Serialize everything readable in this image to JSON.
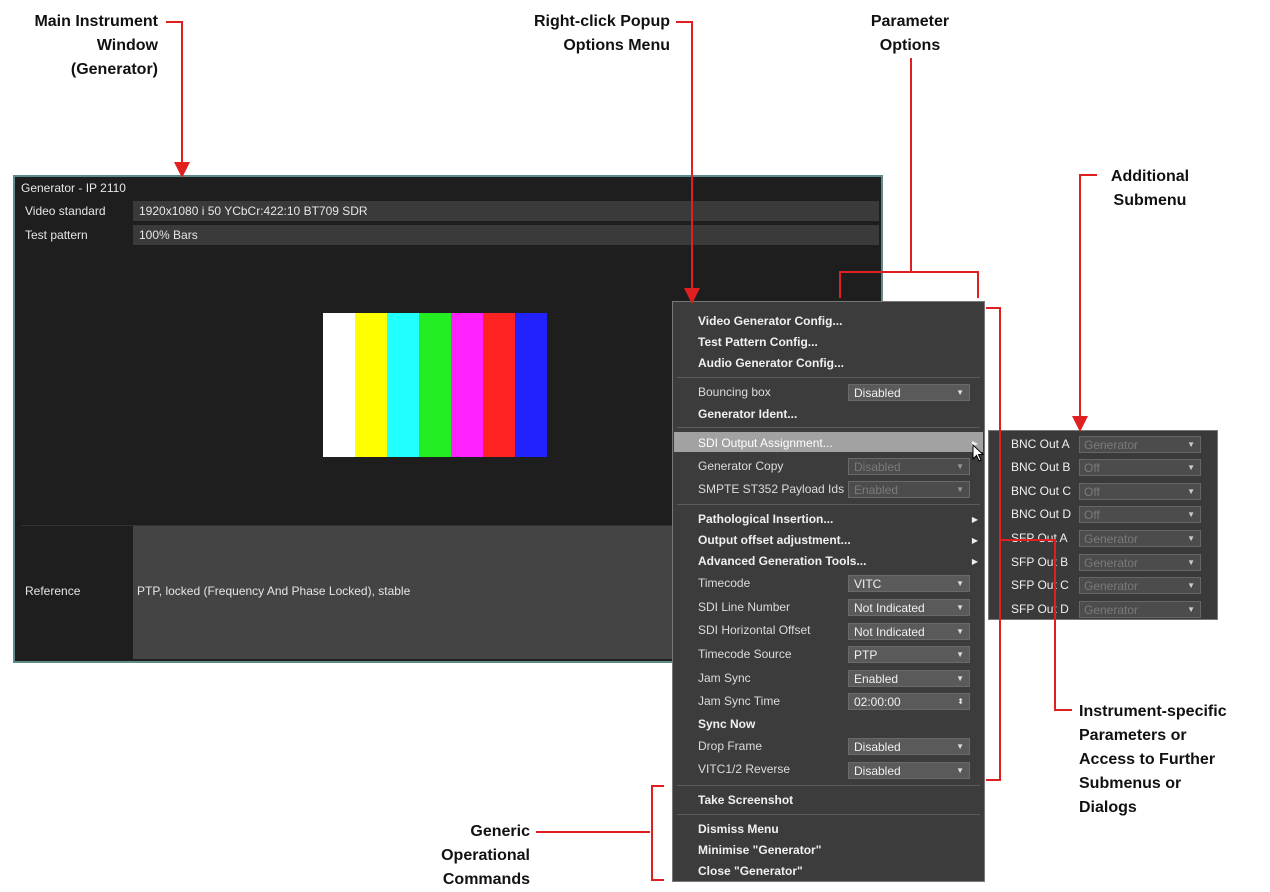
{
  "annotations": {
    "main_window": [
      "Main Instrument",
      "Window",
      "(Generator)"
    ],
    "popup_menu": [
      "Right-click Popup",
      "Options Menu"
    ],
    "parameter_options": [
      "Parameter",
      "Options"
    ],
    "additional_submenu": [
      "Additional",
      "Submenu"
    ],
    "instrument_specific": [
      "Instrument-specific",
      "Parameters or",
      "Access to Further",
      "Submenus or",
      "Dialogs"
    ],
    "generic_commands": [
      "Generic",
      "Operational",
      "Commands"
    ]
  },
  "generator": {
    "title": "Generator - IP 2110",
    "rows": [
      {
        "label": "Video standard",
        "value": "1920x1080 i 50 YCbCr:422:10 BT709 SDR"
      },
      {
        "label": "Test pattern",
        "value": "100% Bars"
      }
    ],
    "bar_colors": [
      "#ffffff",
      "#ffff00",
      "#22ffff",
      "#22ee22",
      "#ff22ff",
      "#ff2222",
      "#2222ff"
    ],
    "reference": {
      "label": "Reference",
      "value": "PTP, locked (Frequency And Phase Locked), stable"
    }
  },
  "popup": {
    "config_items": [
      "Video Generator Config...",
      "Test Pattern Config...",
      "Audio Generator Config..."
    ],
    "bouncing_box": {
      "label": "Bouncing box",
      "value": "Disabled"
    },
    "generator_ident": "Generator Ident...",
    "sdi_output_assignment": "SDI Output Assignment...",
    "generator_copy": {
      "label": "Generator Copy",
      "value": "Disabled"
    },
    "smpte_payload": {
      "label": "SMPTE ST352 Payload Ids",
      "value": "Enabled"
    },
    "pathological": "Pathological Insertion...",
    "output_offset": "Output offset adjustment...",
    "advanced_tools": "Advanced Generation Tools...",
    "timecode": {
      "label": "Timecode",
      "value": "VITC"
    },
    "sdi_line_number": {
      "label": "SDI Line Number",
      "value": "Not Indicated"
    },
    "sdi_horizontal_offset": {
      "label": "SDI Horizontal Offset",
      "value": "Not Indicated"
    },
    "timecode_source": {
      "label": "Timecode Source",
      "value": "PTP"
    },
    "jam_sync": {
      "label": "Jam Sync",
      "value": "Enabled"
    },
    "jam_sync_time": {
      "label": "Jam Sync Time",
      "value": "02:00:00"
    },
    "sync_now": "Sync Now",
    "drop_frame": {
      "label": "Drop Frame",
      "value": "Disabled"
    },
    "vitc_reverse": {
      "label": "VITC1/2 Reverse",
      "value": "Disabled"
    },
    "take_screenshot": "Take Screenshot",
    "dismiss": "Dismiss Menu",
    "minimise": "Minimise \"Generator\"",
    "close": "Close \"Generator\""
  },
  "submenu": {
    "rows": [
      {
        "label": "BNC Out A",
        "value": "Generator"
      },
      {
        "label": "BNC Out B",
        "value": "Off"
      },
      {
        "label": "BNC Out C",
        "value": "Off"
      },
      {
        "label": "BNC Out D",
        "value": "Off"
      },
      {
        "label": "SFP Out A",
        "value": "Generator"
      },
      {
        "label": "SFP Out B",
        "value": "Generator"
      },
      {
        "label": "SFP Out C",
        "value": "Generator"
      },
      {
        "label": "SFP Out D",
        "value": "Generator"
      }
    ]
  },
  "colors": {
    "annotation_line": "#e02020",
    "window_border": "#5f8c8a",
    "menu_bg": "#3c3c3c",
    "highlight": "#a2a2a2"
  }
}
